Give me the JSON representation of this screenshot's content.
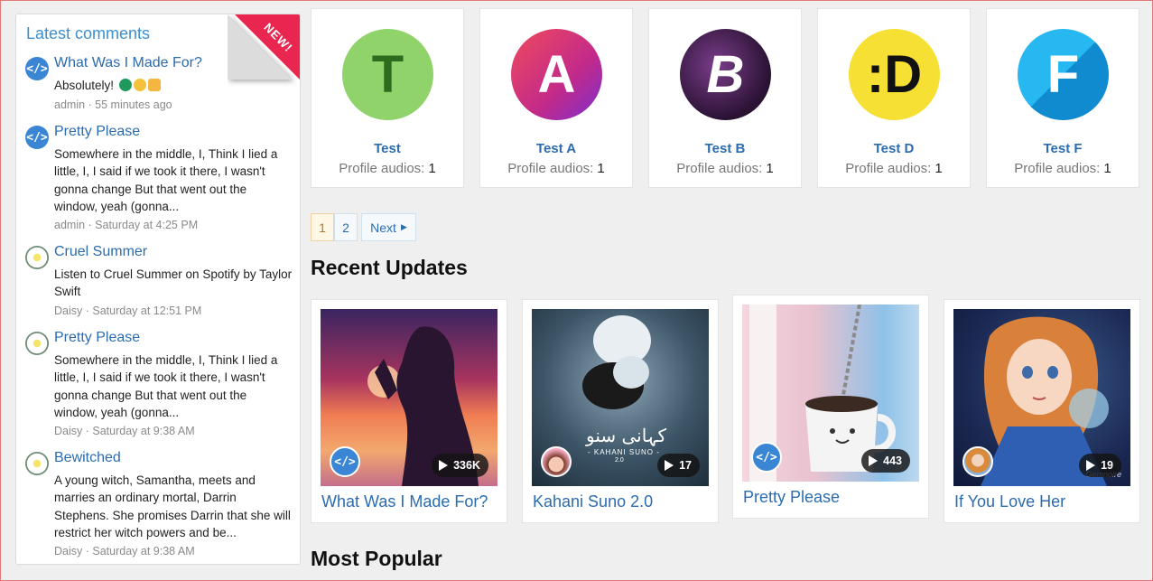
{
  "sidebar": {
    "title": "Latest comments",
    "ribbon": "NEW!",
    "comments": [
      {
        "title": "What Was I Made For?",
        "body": "Absolutely!",
        "author": "admin",
        "time": "55 minutes ago",
        "avatar": "dev-avatar"
      },
      {
        "title": "Pretty Please",
        "body": "Somewhere in the middle, I, Think I lied a little, I, I said if we took it there, I wasn't gonna change But that went out the window, yeah (gonna...",
        "author": "admin",
        "time": "Saturday at 4:25 PM",
        "avatar": "dev-avatar"
      },
      {
        "title": "Cruel Summer",
        "body": "Listen to Cruel Summer on Spotify by Taylor Swift",
        "author": "Daisy",
        "time": "Saturday at 12:51 PM",
        "avatar": "daisy-avatar"
      },
      {
        "title": "Pretty Please",
        "body": "Somewhere in the middle, I, Think I lied a little, I, I said if we took it there, I wasn't gonna change But that went out the window, yeah (gonna...",
        "author": "Daisy",
        "time": "Saturday at 9:38 AM",
        "avatar": "daisy-avatar"
      },
      {
        "title": "Bewitched",
        "body": "A young witch, Samantha, meets and marries an ordinary mortal, Darrin Stephens. She promises Darrin that she will restrict her witch powers and be...",
        "author": "Daisy",
        "time": "Saturday at 9:38 AM",
        "avatar": "daisy-avatar"
      }
    ],
    "meta_separator": " · "
  },
  "profiles": [
    {
      "initial": "T",
      "name": "Test",
      "label": "Profile audios:",
      "count": "1",
      "bg": "#8fd36a",
      "fg": "#2f6b1e"
    },
    {
      "initial": "A",
      "name": "Test A",
      "label": "Profile audios:",
      "count": "1",
      "bg": "#d6306e",
      "fg": "#ffffff"
    },
    {
      "initial": "B",
      "name": "Test B",
      "label": "Profile audios:",
      "count": "1",
      "bg": "#2a1233",
      "fg": "#ffffff"
    },
    {
      "initial": ":D",
      "name": "Test D",
      "label": "Profile audios:",
      "count": "1",
      "bg": "#f6e034",
      "fg": "#111111"
    },
    {
      "initial": "F",
      "name": "Test F",
      "label": "Profile audios:",
      "count": "1",
      "bg": "#1aa7e8",
      "fg": "#ffffff"
    }
  ],
  "pagination": {
    "pages": [
      "1",
      "2"
    ],
    "active": "1",
    "next": "Next"
  },
  "sections": {
    "recent": "Recent Updates",
    "popular": "Most Popular"
  },
  "recent": [
    {
      "title": "What Was I Made For?",
      "plays": "336K"
    },
    {
      "title": "Kahani Suno 2.0",
      "plays": "17",
      "overlay": "کہانی سنو",
      "overlay_sub": "- KAHANI SUNO -",
      "overlay_ver": "2.0"
    },
    {
      "title": "Pretty Please",
      "plays": "443"
    },
    {
      "title": "If You Love Her",
      "plays": "19",
      "watermark": "Gemnoire"
    }
  ],
  "colors": {
    "accent": "#2b6cb0",
    "ribbon": "#e8264f",
    "sidebar_title": "#3b8fd0"
  }
}
